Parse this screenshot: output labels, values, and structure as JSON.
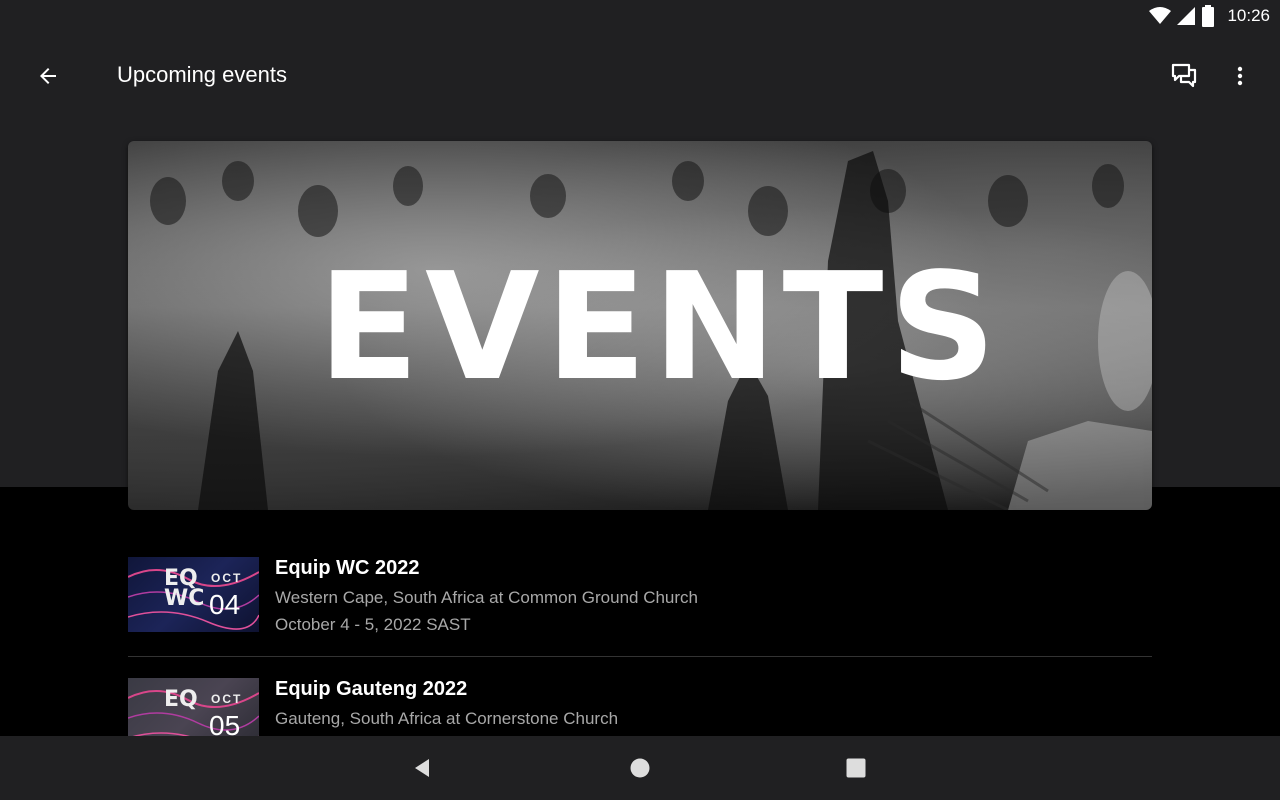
{
  "status_bar": {
    "time": "10:26",
    "icons": [
      "wifi-icon",
      "signal-icon",
      "battery-icon"
    ]
  },
  "app_bar": {
    "title": "Upcoming events",
    "actions": [
      "back-arrow-icon",
      "chat-icon",
      "more-vert-icon"
    ]
  },
  "banner": {
    "text": "EVENTS"
  },
  "events": [
    {
      "title": "Equip WC 2022",
      "location": "Western Cape, South Africa at Common Ground Church",
      "date": "October 4 - 5, 2022 SAST",
      "thumb_month": "OCT",
      "thumb_day": "04",
      "thumb_logo": "EQ\nWC"
    },
    {
      "title": "Equip Gauteng 2022",
      "location": "Gauteng, South Africa at Cornerstone Church",
      "date": "",
      "thumb_month": "OCT",
      "thumb_day": "05",
      "thumb_logo": "EQ"
    }
  ],
  "nav_bar": {
    "buttons": [
      "back-triangle-icon",
      "home-circle-icon",
      "recents-square-icon"
    ]
  },
  "colors": {
    "app_bar": "#202022",
    "background": "#000000",
    "secondary_text": "#a8a8a8"
  }
}
